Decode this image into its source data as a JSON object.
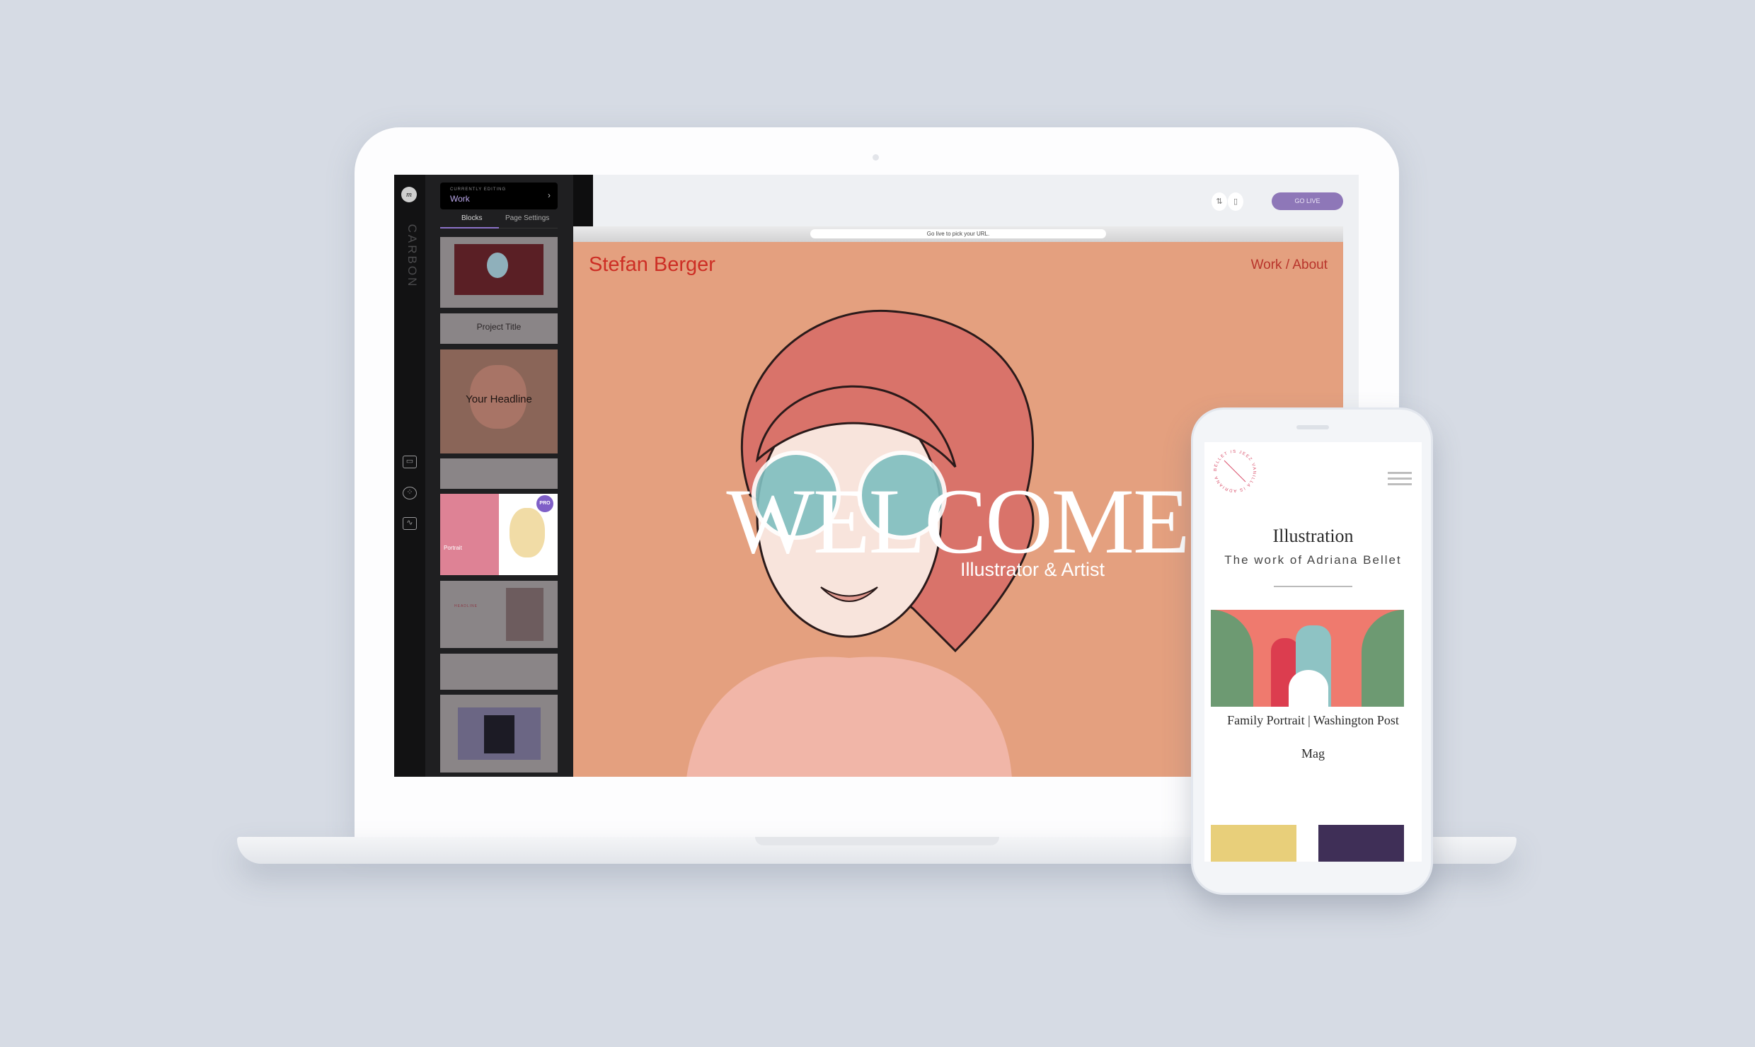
{
  "editor": {
    "brand": "CARBON",
    "logo": "m",
    "currently_editing_label": "CURRENTLY EDITING",
    "currently_editing_value": "Work",
    "tabs": [
      {
        "label": "Blocks",
        "active": true
      },
      {
        "label": "Page Settings",
        "active": false
      }
    ],
    "rail_icons": [
      "briefcase-icon",
      "palette-icon",
      "analytics-icon"
    ],
    "blocks": [
      {
        "type": "image"
      },
      {
        "title": "Project Title"
      },
      {
        "title": "Your Headline"
      },
      {
        "type": "text"
      },
      {
        "title": "Portrait",
        "badge": "PRO"
      },
      {
        "title": "HEADLINE"
      },
      {
        "type": "text-columns"
      },
      {
        "type": "gallery"
      }
    ],
    "toolbar": {
      "go_live": "GO LIVE",
      "accent": "#8e77b8"
    },
    "url_hint": "Go live to pick your URL."
  },
  "site": {
    "name": "Stefan Berger",
    "nav": "Work / About",
    "headline": "WELCOME",
    "subtitle": "Illustrator & Artist",
    "background": "#e4a07f",
    "accent": "#cd2e25"
  },
  "mobile": {
    "stamp_text": "BELLET IS JEEZ VANILLA IS ADRIANA",
    "title": "Illustration",
    "subtitle": "The work of Adriana Bellet",
    "caption": "Family Portrait | Washington Post Mag"
  }
}
